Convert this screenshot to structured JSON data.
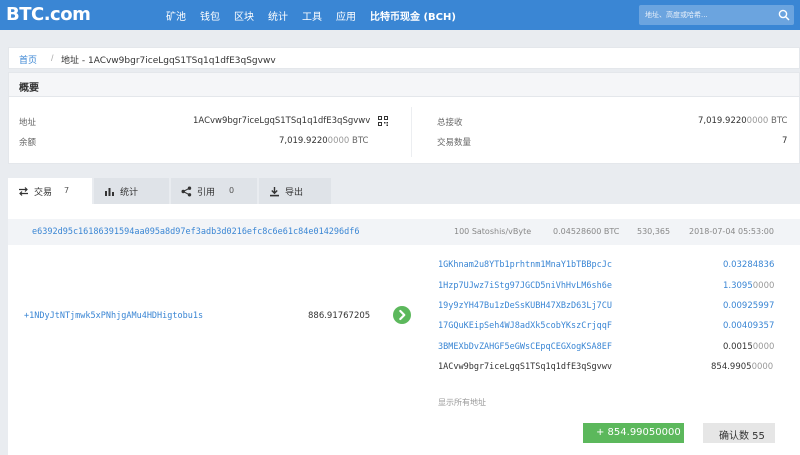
{
  "header": {
    "logo": "BTC.com",
    "nav": [
      "矿池",
      "钱包",
      "区块",
      "统计",
      "工具",
      "应用",
      "比特币现金 (BCH)"
    ],
    "search_placeholder": "地址、高度或哈希..."
  },
  "breadcrumb": {
    "home": "首页",
    "separator": "/",
    "current": "地址 - 1ACvw9bgr7iceLgqS1TSq1q1dfE3qSgvwv"
  },
  "overview": {
    "title": "概要",
    "address_label": "地址",
    "address_value": "1ACvw9bgr7iceLgqS1TSq1q1dfE3qSgvwv",
    "balance_label": "余额",
    "balance_main": "7,019.9220",
    "balance_zeros": "0000",
    "balance_unit": "BTC",
    "received_label": "总接收",
    "received_main": "7,019.9220",
    "received_zeros": "0000",
    "received_unit": "BTC",
    "txcount_label": "交易数量",
    "txcount_value": "7"
  },
  "tabs": [
    {
      "label": "交易",
      "count": "7",
      "icon": "transfer-icon"
    },
    {
      "label": "统计",
      "icon": "bar-chart-icon"
    },
    {
      "label": "引用",
      "count": "0",
      "icon": "share-icon"
    },
    {
      "label": "导出",
      "icon": "download-icon"
    }
  ],
  "transaction": {
    "hash": "e6392d95c16186391594aa095a8d97ef3adb3d0216efc8c6e61c84e014296df6",
    "fee_rate": "100 Satoshis/vByte",
    "fee": "0.04528600 BTC",
    "block_height": "530,365",
    "time": "2018-07-04 05:53:00",
    "input": {
      "address": "+1NDyJtNTjmwk5xPNhjgAMu4HDHigtobu1s",
      "amount": "886.91767205"
    },
    "outputs": [
      {
        "address": "1GKhnam2u8YTb1prhtnm1MnaY1bTBBpcJc",
        "main": "0.03284836",
        "zeros": "",
        "link": true
      },
      {
        "address": "1Hzp7UJwz7iStg97JGCD5niVhHvLM6sh6e",
        "main": "1.3095",
        "zeros": "0000",
        "link": true
      },
      {
        "address": "19y9zYH47Bu1zDeSsKUBH47XBzD63Lj7CU",
        "main": "0.00925997",
        "zeros": "",
        "link": true
      },
      {
        "address": "17GQuKEipSeh4WJ8adXk5cobYKszCrjqqF",
        "main": "0.00409357",
        "zeros": "",
        "link": true
      },
      {
        "address": "3BMEXbDvZAHGF5eGWsCEpqCEGXogKSA8EF",
        "main": "0.0015",
        "zeros": "0000",
        "link": true
      },
      {
        "address": "1ACvw9bgr7iceLgqS1TSq1q1dfE3qSgvwv",
        "main": "854.9905",
        "zeros": "0000",
        "link": false
      }
    ],
    "show_all": "显示所有地址",
    "net_change": "+ 854.99050000",
    "confirmations": "确认数 55"
  },
  "colors": {
    "brand": "#3a86d4",
    "positive": "#5cb85c"
  }
}
